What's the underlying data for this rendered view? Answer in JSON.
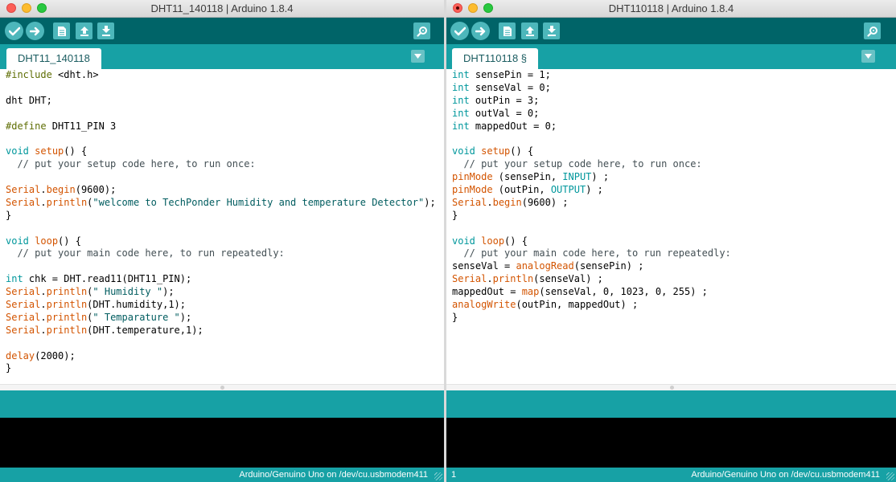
{
  "left_window": {
    "title": "DHT11_140118 | Arduino 1.8.4",
    "tab_label": "DHT11_140118",
    "code": [
      [
        {
          "t": "#include",
          "c": "pp"
        },
        {
          "t": " <dht.h>",
          "c": ""
        }
      ],
      [],
      [
        {
          "t": "dht DHT;",
          "c": ""
        }
      ],
      [],
      [
        {
          "t": "#define",
          "c": "pp"
        },
        {
          "t": " DHT11_PIN 3",
          "c": ""
        }
      ],
      [],
      [
        {
          "t": "void",
          "c": "kw"
        },
        {
          "t": " ",
          "c": ""
        },
        {
          "t": "setup",
          "c": "fn"
        },
        {
          "t": "() {",
          "c": ""
        }
      ],
      [
        {
          "t": "  // put your setup code here, to run once:",
          "c": "cm"
        }
      ],
      [],
      [
        {
          "t": "Serial",
          "c": "fn"
        },
        {
          "t": ".",
          "c": ""
        },
        {
          "t": "begin",
          "c": "fn"
        },
        {
          "t": "(9600);",
          "c": ""
        }
      ],
      [
        {
          "t": "Serial",
          "c": "fn"
        },
        {
          "t": ".",
          "c": ""
        },
        {
          "t": "println",
          "c": "fn"
        },
        {
          "t": "(",
          "c": ""
        },
        {
          "t": "\"welcome to TechPonder Humidity and temperature Detector\"",
          "c": "st"
        },
        {
          "t": ");",
          "c": ""
        }
      ],
      [
        {
          "t": "}",
          "c": ""
        }
      ],
      [],
      [
        {
          "t": "void",
          "c": "kw"
        },
        {
          "t": " ",
          "c": ""
        },
        {
          "t": "loop",
          "c": "fn"
        },
        {
          "t": "() {",
          "c": ""
        }
      ],
      [
        {
          "t": "  // put your main code here, to run repeatedly:",
          "c": "cm"
        }
      ],
      [],
      [
        {
          "t": "int",
          "c": "kw"
        },
        {
          "t": " chk = DHT.read11(DHT11_PIN);",
          "c": ""
        }
      ],
      [
        {
          "t": "Serial",
          "c": "fn"
        },
        {
          "t": ".",
          "c": ""
        },
        {
          "t": "println",
          "c": "fn"
        },
        {
          "t": "(",
          "c": ""
        },
        {
          "t": "\" Humidity \"",
          "c": "st"
        },
        {
          "t": ");",
          "c": ""
        }
      ],
      [
        {
          "t": "Serial",
          "c": "fn"
        },
        {
          "t": ".",
          "c": ""
        },
        {
          "t": "println",
          "c": "fn"
        },
        {
          "t": "(DHT.humidity,1);",
          "c": ""
        }
      ],
      [
        {
          "t": "Serial",
          "c": "fn"
        },
        {
          "t": ".",
          "c": ""
        },
        {
          "t": "println",
          "c": "fn"
        },
        {
          "t": "(",
          "c": ""
        },
        {
          "t": "\" Temparature \"",
          "c": "st"
        },
        {
          "t": ");",
          "c": ""
        }
      ],
      [
        {
          "t": "Serial",
          "c": "fn"
        },
        {
          "t": ".",
          "c": ""
        },
        {
          "t": "println",
          "c": "fn"
        },
        {
          "t": "(DHT.temperature,1);",
          "c": ""
        }
      ],
      [],
      [
        {
          "t": "delay",
          "c": "fn"
        },
        {
          "t": "(2000);",
          "c": ""
        }
      ],
      [
        {
          "t": "}",
          "c": ""
        }
      ]
    ],
    "status_board": "Arduino/Genuino Uno on /dev/cu.usbmodem411"
  },
  "right_window": {
    "title": "DHT110118 | Arduino 1.8.4",
    "tab_label": "DHT110118 §",
    "code": [
      [
        {
          "t": "int",
          "c": "kw"
        },
        {
          "t": " sensePin = 1;",
          "c": ""
        }
      ],
      [
        {
          "t": "int",
          "c": "kw"
        },
        {
          "t": " senseVal = 0;",
          "c": ""
        }
      ],
      [
        {
          "t": "int",
          "c": "kw"
        },
        {
          "t": " outPin = 3;",
          "c": ""
        }
      ],
      [
        {
          "t": "int",
          "c": "kw"
        },
        {
          "t": " outVal = 0;",
          "c": ""
        }
      ],
      [
        {
          "t": "int",
          "c": "kw"
        },
        {
          "t": " mappedOut = 0;",
          "c": ""
        }
      ],
      [],
      [
        {
          "t": "void",
          "c": "kw"
        },
        {
          "t": " ",
          "c": ""
        },
        {
          "t": "setup",
          "c": "fn"
        },
        {
          "t": "() {",
          "c": ""
        }
      ],
      [
        {
          "t": "  // put your setup code here, to run once:",
          "c": "cm"
        }
      ],
      [
        {
          "t": "pinMode",
          "c": "fn"
        },
        {
          "t": " (sensePin, ",
          "c": ""
        },
        {
          "t": "INPUT",
          "c": "cn"
        },
        {
          "t": ") ;",
          "c": ""
        }
      ],
      [
        {
          "t": "pinMode",
          "c": "fn"
        },
        {
          "t": " (outPin, ",
          "c": ""
        },
        {
          "t": "OUTPUT",
          "c": "cn"
        },
        {
          "t": ") ;",
          "c": ""
        }
      ],
      [
        {
          "t": "Serial",
          "c": "fn"
        },
        {
          "t": ".",
          "c": ""
        },
        {
          "t": "begin",
          "c": "fn"
        },
        {
          "t": "(9600) ;",
          "c": ""
        }
      ],
      [
        {
          "t": "}",
          "c": ""
        }
      ],
      [],
      [
        {
          "t": "void",
          "c": "kw"
        },
        {
          "t": " ",
          "c": ""
        },
        {
          "t": "loop",
          "c": "fn"
        },
        {
          "t": "() {",
          "c": ""
        }
      ],
      [
        {
          "t": "  // put your main code here, to run repeatedly:",
          "c": "cm"
        }
      ],
      [
        {
          "t": "senseVal = ",
          "c": ""
        },
        {
          "t": "analogRead",
          "c": "fn"
        },
        {
          "t": "(sensePin) ;",
          "c": ""
        }
      ],
      [
        {
          "t": "Serial",
          "c": "fn"
        },
        {
          "t": ".",
          "c": ""
        },
        {
          "t": "println",
          "c": "fn"
        },
        {
          "t": "(senseVal) ;",
          "c": ""
        }
      ],
      [
        {
          "t": "mappedOut = ",
          "c": ""
        },
        {
          "t": "map",
          "c": "fn"
        },
        {
          "t": "(senseVal, 0, 1023, 0, 255) ;",
          "c": ""
        }
      ],
      [
        {
          "t": "analogWrite",
          "c": "fn"
        },
        {
          "t": "(outPin, mappedOut) ;",
          "c": ""
        }
      ],
      [
        {
          "t": "}",
          "c": ""
        }
      ]
    ],
    "status_line": "1",
    "status_board": "Arduino/Genuino Uno on /dev/cu.usbmodem411"
  },
  "colors": {
    "toolbar": "#006468",
    "tabbar": "#17a1a5",
    "button": "#4db7bb",
    "keyword": "#00979c",
    "function": "#d35400",
    "preprocessor": "#5e6d03",
    "comment": "#434f54",
    "string": "#005c5f"
  },
  "icons": {
    "verify": "check-icon",
    "upload": "arrow-right-icon",
    "new": "new-file-icon",
    "open": "open-arrow-up-icon",
    "save": "save-arrow-down-icon",
    "serial_monitor": "magnifier-icon",
    "tab_menu": "triangle-down-icon"
  }
}
